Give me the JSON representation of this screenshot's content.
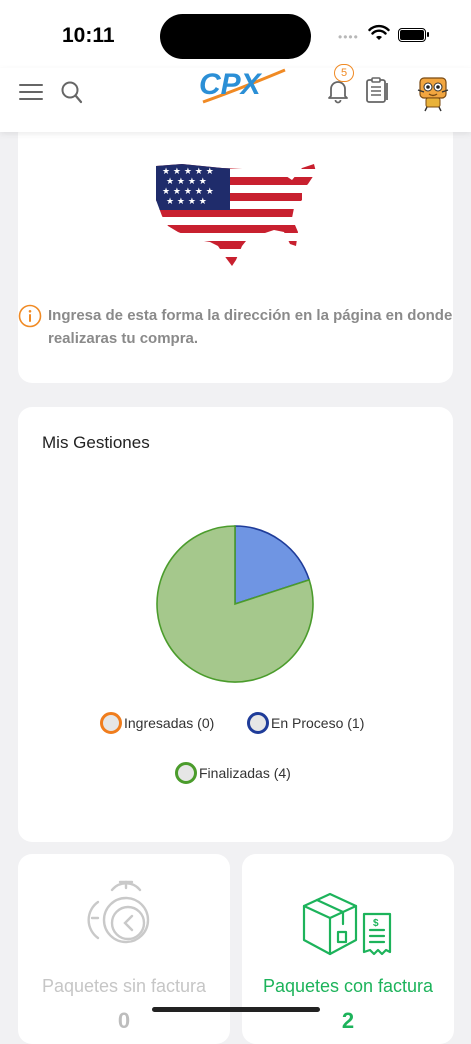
{
  "status_bar": {
    "time": "10:11"
  },
  "header": {
    "logo_text": "CPX",
    "notification_count": "5"
  },
  "address_card": {
    "info_text": "Ingresa de esta forma la dirección en la página en donde realizaras tu compra."
  },
  "gestiones": {
    "title": "Mis Gestiones",
    "legend": [
      {
        "label": "Ingresadas (0)",
        "color": "#f07d1d"
      },
      {
        "label": "En Proceso (1)",
        "color": "#1f3c99"
      },
      {
        "label": "Finalizadas (4)",
        "color": "#4b9c2c"
      }
    ]
  },
  "chart_data": {
    "type": "pie",
    "categories": [
      "Ingresadas",
      "En Proceso",
      "Finalizadas"
    ],
    "values": [
      0,
      1,
      4
    ],
    "colors": [
      "#f07d1d",
      "#6f95e3",
      "#a5c88c"
    ]
  },
  "packages": {
    "sin_factura": {
      "label": "Paquetes sin factura",
      "count": "0"
    },
    "con_factura": {
      "label": "Paquetes con factura",
      "count": "2"
    }
  }
}
